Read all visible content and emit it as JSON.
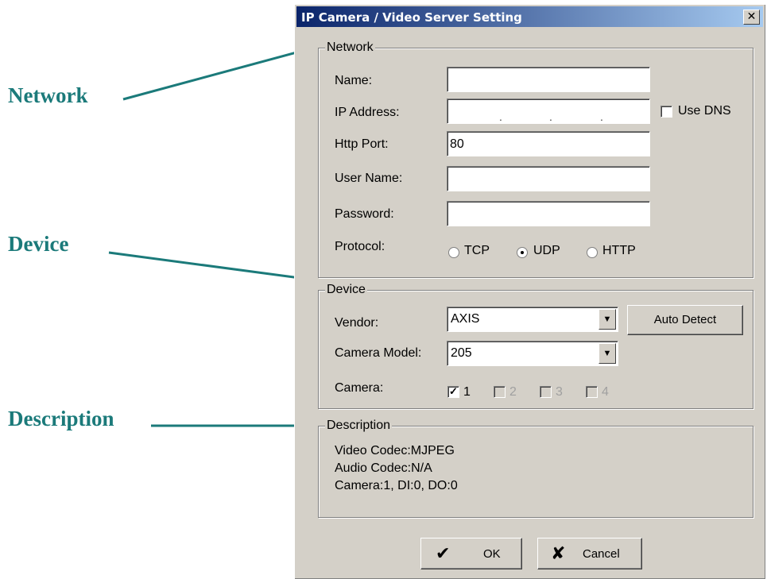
{
  "annotations": {
    "network": "Network",
    "device": "Device",
    "description": "Description"
  },
  "dialog": {
    "title": "IP Camera / Video Server Setting",
    "close_glyph": "✕"
  },
  "network": {
    "legend": "Network",
    "name_label": "Name:",
    "name_value": "",
    "ip_label": "IP Address:",
    "ip_value": "",
    "use_dns_label": "Use DNS",
    "use_dns_checked": false,
    "http_port_label": "Http Port:",
    "http_port_value": "80",
    "user_name_label": "User Name:",
    "user_name_value": "",
    "password_label": "Password:",
    "password_value": "",
    "protocol_label": "Protocol:",
    "protocols": [
      "TCP",
      "UDP",
      "HTTP"
    ],
    "protocol_selected": "UDP"
  },
  "device": {
    "legend": "Device",
    "vendor_label": "Vendor:",
    "vendor_value": "AXIS",
    "auto_detect_label": "Auto Detect",
    "camera_model_label": "Camera Model:",
    "camera_model_value": "205",
    "camera_label": "Camera:",
    "cameras": [
      {
        "label": "1",
        "checked": true,
        "enabled": true
      },
      {
        "label": "2",
        "checked": false,
        "enabled": false
      },
      {
        "label": "3",
        "checked": false,
        "enabled": false
      },
      {
        "label": "4",
        "checked": false,
        "enabled": false
      }
    ]
  },
  "description": {
    "legend": "Description",
    "lines": [
      "Video Codec:MJPEG",
      "Audio Codec:N/A",
      "Camera:1, DI:0, DO:0"
    ]
  },
  "buttons": {
    "ok_label": "OK",
    "cancel_label": "Cancel",
    "ok_icon": "checkmark-icon",
    "cancel_icon": "x-icon"
  },
  "colors": {
    "callout": "#1b7a7a",
    "dialog_bg": "#d4d0c8",
    "title_bar_start": "#0a246a"
  }
}
